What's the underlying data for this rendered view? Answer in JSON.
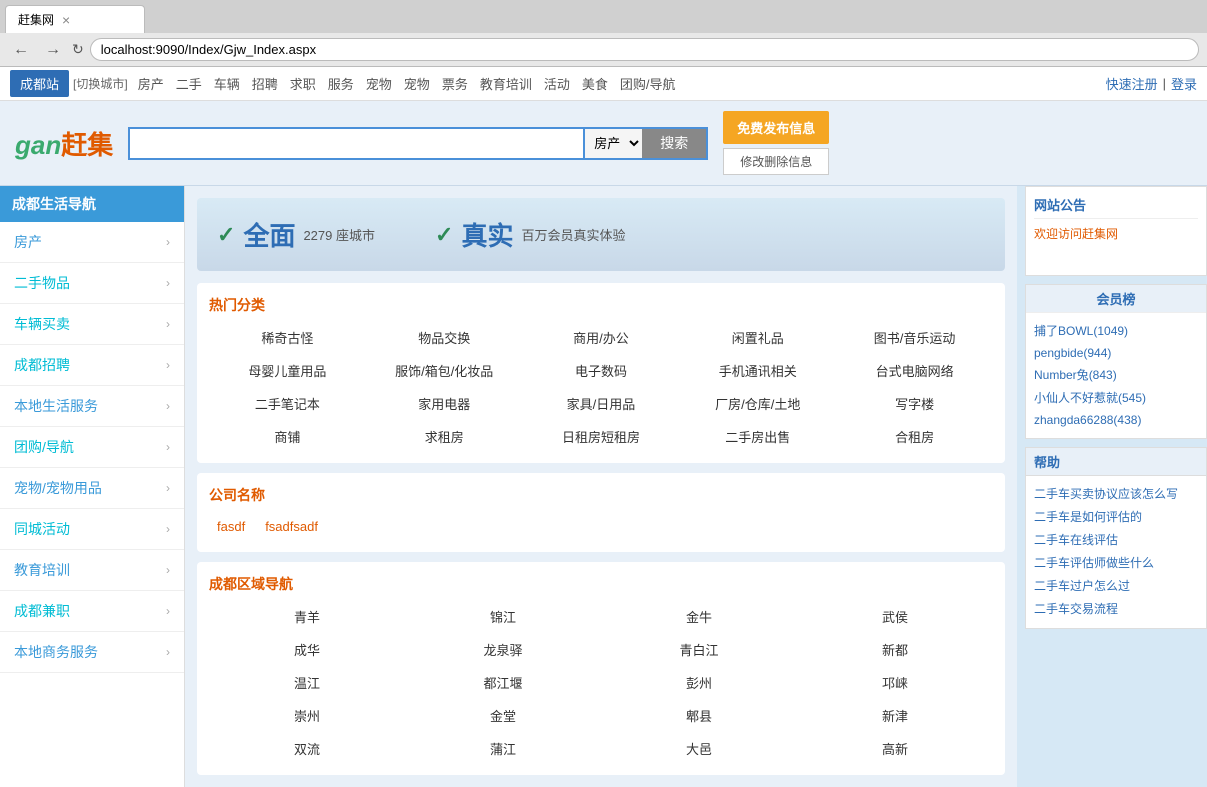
{
  "browser": {
    "tab_title": "赶集网",
    "url": "localhost:9090/Index/Gjw_Index.aspx",
    "close_label": "×"
  },
  "topnav": {
    "city": "成都站",
    "switch_city": "[切换城市]",
    "links": [
      "房产",
      "二手",
      "车辆",
      "招聘",
      "求职",
      "服务",
      "宠物",
      "宠物",
      "票务",
      "教育培训",
      "活动",
      "美食",
      "团购/导航"
    ],
    "quick_register": "快速注册",
    "separator": "|",
    "login": "登录"
  },
  "header": {
    "logo_gan": "gan",
    "logo_mark": "赶",
    "logo_ji": "集",
    "search_placeholder": "",
    "search_category": "房产",
    "search_btn": "搜索",
    "free_post_btn": "免费发布信息",
    "modify_btn": "修改删除信息"
  },
  "sidebar": {
    "title": "成都生活导航",
    "items": [
      {
        "label": "房产",
        "arrow": "›"
      },
      {
        "label": "二手物品",
        "arrow": "›"
      },
      {
        "label": "车辆买卖",
        "arrow": "›"
      },
      {
        "label": "成都招聘",
        "arrow": "›"
      },
      {
        "label": "本地生活服务",
        "arrow": "›"
      },
      {
        "label": "团购/导航",
        "arrow": "›"
      },
      {
        "label": "宠物/宠物用品",
        "arrow": "›"
      },
      {
        "label": "同城活动",
        "arrow": "›"
      },
      {
        "label": "教育培训",
        "arrow": "›"
      },
      {
        "label": "成都兼职",
        "arrow": "›"
      },
      {
        "label": "本地商务服务",
        "arrow": "›"
      }
    ]
  },
  "banner": {
    "check1": "✓",
    "text1": "全面",
    "sub1": "2279 座城市",
    "check2": "✓",
    "text2": "真实",
    "sub2": "百万会员真实体验"
  },
  "hot_categories": {
    "title": "热门分类",
    "items": [
      "稀奇古怪",
      "物品交换",
      "商用/办公",
      "闲置礼品",
      "图书/音乐运动",
      "母婴儿童用品",
      "服饰/箱包/化妆品",
      "电子数码",
      "手机通讯相关",
      "台式电脑网络",
      "二手笔记本",
      "家用电器",
      "家具/日用品",
      "厂房/仓库/土地",
      "写字楼",
      "商铺",
      "求租房",
      "日租房短租房",
      "二手房出售",
      "合租房"
    ]
  },
  "company": {
    "title": "公司名称",
    "items": [
      "fasdf",
      "fsadfsadf"
    ]
  },
  "district": {
    "title": "成都区域导航",
    "items": [
      "青羊",
      "锦江",
      "金牛",
      "武侯",
      "成华",
      "龙泉驿",
      "青白江",
      "新都",
      "温江",
      "都江堰",
      "彭州",
      "邛崃",
      "崇州",
      "金堂",
      "郫县",
      "新津",
      "双流",
      "蒲江",
      "大邑",
      "高新"
    ]
  },
  "right_sidebar": {
    "announcement_title": "网站公告",
    "announcement_content": "欢迎访问赶集网",
    "member_title": "会员榜",
    "members": [
      {
        "name": "捕了BOWL",
        "count": "(1049)"
      },
      {
        "name": "pengbide",
        "count": "(944)"
      },
      {
        "name": "Number兔",
        "count": "(843)"
      },
      {
        "name": "小仙人不好惹就",
        "count": "(545)"
      },
      {
        "name": "zhangda66288",
        "count": "(438)"
      }
    ],
    "help_title": "帮助",
    "help_items": [
      "二手车买卖协议应该怎么写",
      "二手车是如何评估的",
      "二手车在线评估",
      "二手车评估师做些什么",
      "二手车过户怎么过",
      "二手车交易流程"
    ]
  }
}
